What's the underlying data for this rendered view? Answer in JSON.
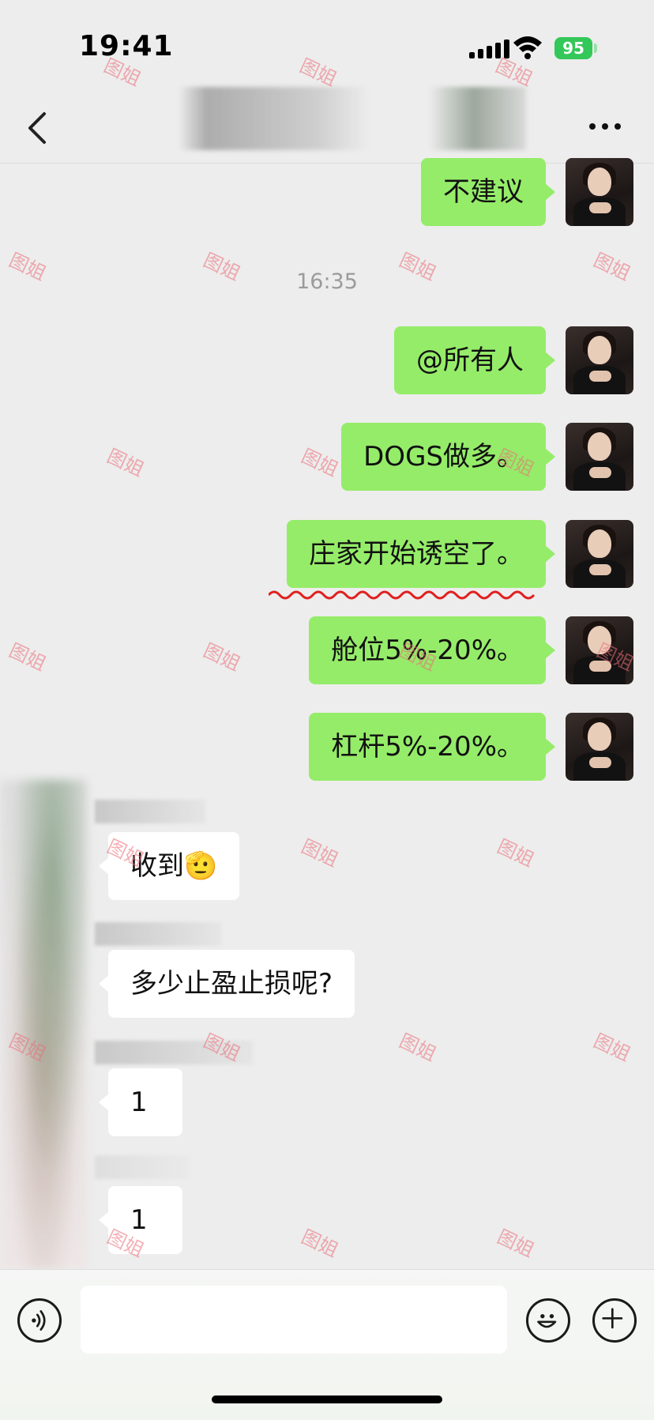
{
  "status_bar": {
    "time": "19:41",
    "battery": "95"
  },
  "chat": {
    "timestamp": "16:35",
    "outgoing": [
      {
        "text": "不建议"
      },
      {
        "text": "@所有人"
      },
      {
        "text": "DOGS做多。"
      },
      {
        "text": "庄家开始诱空了。"
      },
      {
        "text": "舱位5%-20%。"
      },
      {
        "text": "杠杆5%-20%。"
      }
    ],
    "incoming": [
      {
        "text": "收到🫡"
      },
      {
        "text": "多少止盈止损呢?"
      },
      {
        "text": "1"
      },
      {
        "text": "1"
      }
    ]
  },
  "watermark": "图姐",
  "colors": {
    "bubble_out": "#95ec69",
    "bubble_in": "#ffffff",
    "background": "#ededed",
    "watermark": "#eb6e78"
  },
  "icons": [
    "back-chevron-icon",
    "more-dots-icon",
    "voice-icon",
    "emoji-icon",
    "plus-icon",
    "signal-icon",
    "wifi-icon",
    "battery-icon"
  ]
}
